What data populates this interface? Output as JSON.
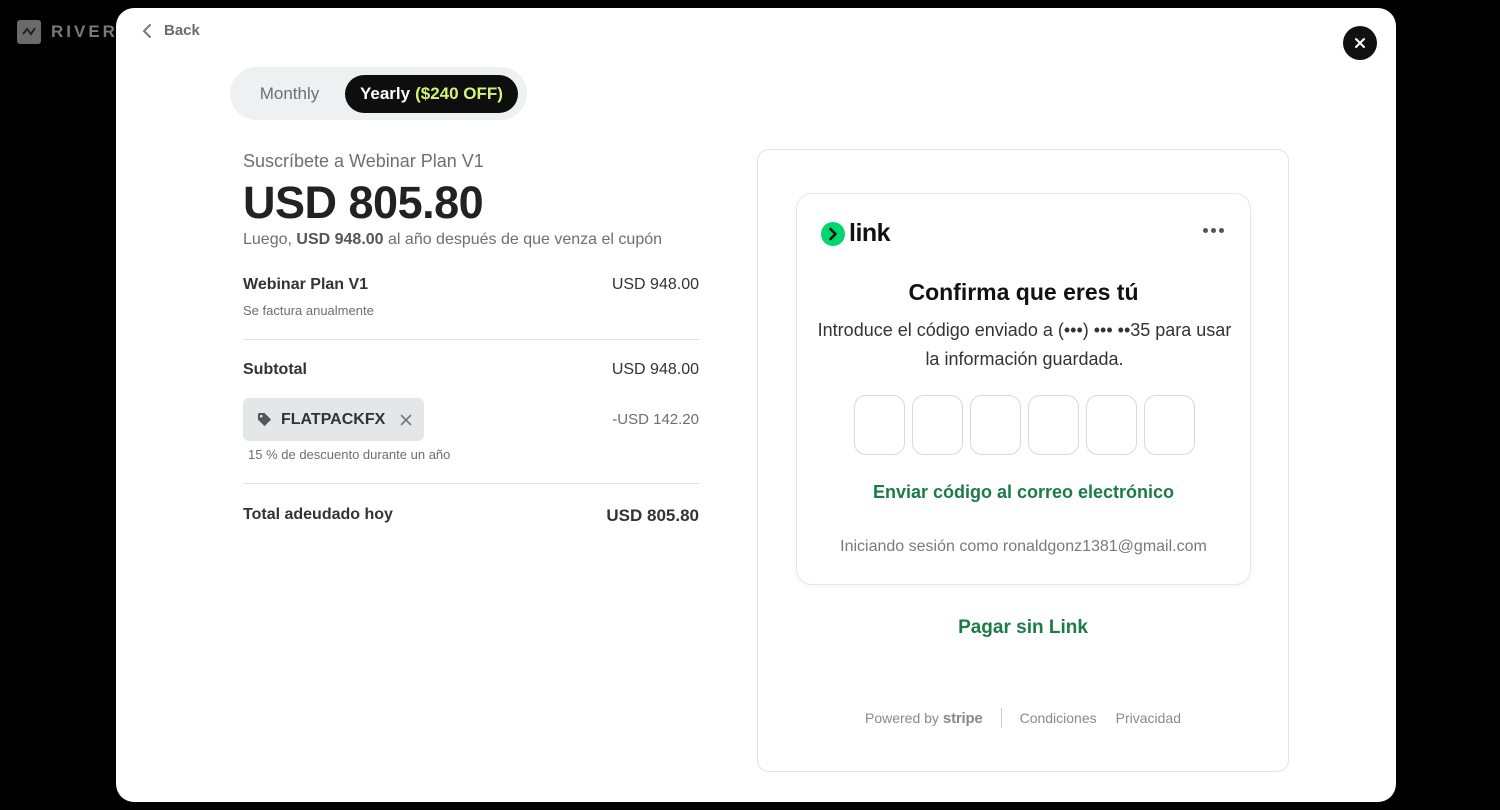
{
  "brand": {
    "name": "RIVER"
  },
  "nav": {
    "back_label": "Back"
  },
  "billing_toggle": {
    "monthly_label": "Monthly",
    "yearly_label": "Yearly",
    "yearly_discount": "($240 OFF)",
    "selected": "Yearly"
  },
  "summary": {
    "subscribe_title": "Suscríbete a Webinar Plan V1",
    "price": "USD 805.80",
    "later_prefix": "Luego,",
    "later_amount": "USD 948.00",
    "later_suffix": "al año después de que venza el cupón",
    "item_name": "Webinar Plan V1",
    "item_billing": "Se factura anualmente",
    "item_amount": "USD 948.00",
    "subtotal_label": "Subtotal",
    "subtotal_amount": "USD 948.00",
    "coupon_code": "FLATPACKFX",
    "coupon_discount": "-USD 142.20",
    "coupon_note": "15 % de descuento durante un año",
    "total_label": "Total adeudado hoy",
    "total_amount": "USD 805.80"
  },
  "link": {
    "logo_text": "link",
    "accent_color": "#00d66f",
    "confirm_title": "Confirma que eres tú",
    "confirm_desc": "Introduce el código enviado a (•••) ••• ••35 para usar la información guardada.",
    "code_digits": 6,
    "email_code_link": "Enviar código al correo electrónico",
    "signed_in_text": "Iniciando sesión como ronaldgonz1381@gmail.com",
    "pay_without_link": "Pagar sin Link"
  },
  "footer": {
    "powered_by": "Powered by",
    "stripe": "stripe",
    "terms": "Condiciones",
    "privacy": "Privacidad"
  },
  "colors": {
    "link_green": "#1a7c46",
    "yearly_accent": "#d4f574",
    "overlay": "#000000"
  }
}
